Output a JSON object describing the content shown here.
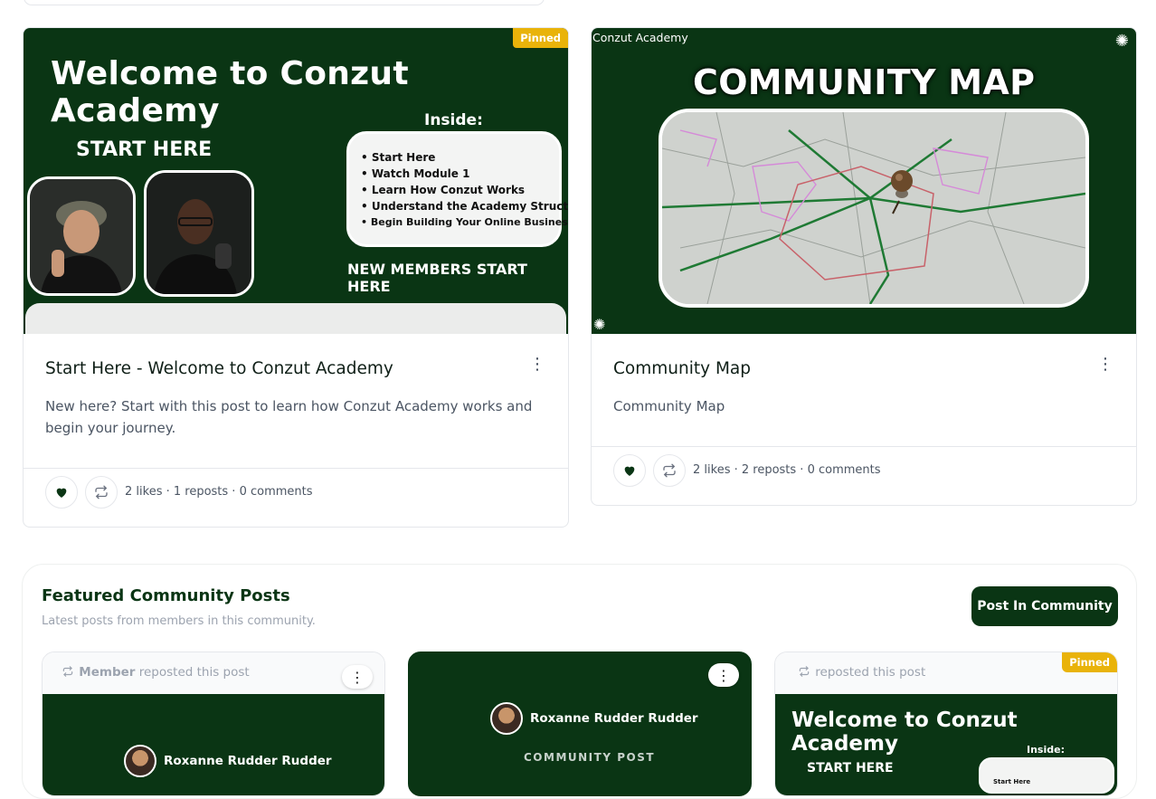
{
  "cards": [
    {
      "pinned": "Pinned",
      "image": {
        "headline": "Welcome to Conzut Academy",
        "start_here": "START HERE",
        "inside_label": "Inside:",
        "inside_items": [
          "Start Here",
          "Watch Module 1",
          "Learn How Conzut Works",
          "Understand the Academy Structure",
          "Begin Building Your Online Business"
        ],
        "footer": "NEW MEMBERS START HERE"
      },
      "title": "Start Here - Welcome to Conzut Academy",
      "description": "New here? Start with this post to learn how Conzut Academy works and begin your journey.",
      "stats": "2 likes · 1 reposts · 0 comments"
    },
    {
      "image": {
        "brand": "Conzut Academy",
        "headline": "COMMUNITY MAP"
      },
      "title": "Community Map",
      "description": "Community Map",
      "stats": "2 likes · 2 reposts · 0 comments"
    }
  ],
  "featured": {
    "title": "Featured Community Posts",
    "subtitle": "Latest posts from members in this community.",
    "post_button": "Post In Community",
    "posts": [
      {
        "repost_user": "Member",
        "repost_text": "reposted this post",
        "author": "Roxanne Rudder Rudder"
      },
      {
        "author": "Roxanne Rudder Rudder",
        "label": "COMMUNITY POST"
      },
      {
        "repost_text": "reposted this post",
        "pinned": "Pinned",
        "headline": "Welcome to Conzut Academy",
        "inside_label": "Inside:",
        "start_here": "START HERE",
        "first_item": "Start Here"
      }
    ]
  },
  "colors": {
    "brand_green": "#0a3514",
    "pinned": "#e9b30a",
    "heart": "#0a3514"
  }
}
